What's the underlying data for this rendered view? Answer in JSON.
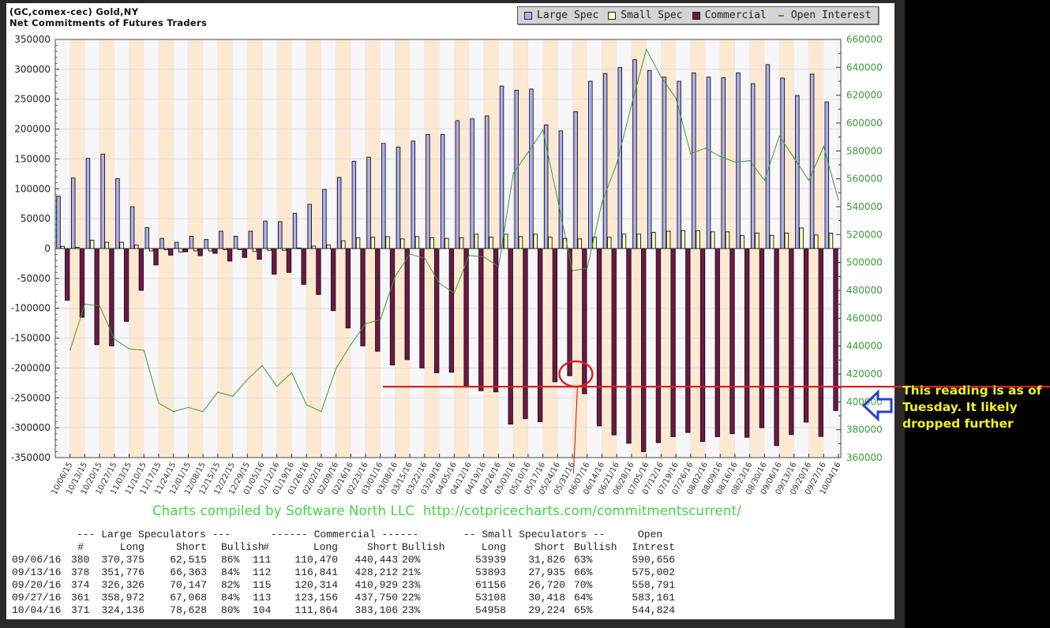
{
  "header": {
    "line1": "(GC,comex-cec) Gold,NY",
    "line2": "Net Commitments of Futures Traders"
  },
  "legend": [
    {
      "label": "Large Spec",
      "color": "#b0b0ee"
    },
    {
      "label": "Small Spec",
      "color": "#ffffc0"
    },
    {
      "label": "Commercial",
      "color": "#6e1846"
    },
    {
      "label": "Open Interest",
      "color": "#3a9a3a"
    }
  ],
  "credit": "Charts compiled by Software North LLC  http://cotpricecharts.com/commitmentscurrent/",
  "annotation": {
    "text1": "This reading is as of",
    "text2": "Tuesday.  It likely",
    "text3": "dropped further"
  },
  "table": {
    "group_headers": {
      "large": "--- Large Speculators ---",
      "commercial": "------ Commercial ------",
      "small": "-- Small Speculators --",
      "oi": "Open"
    },
    "columns": [
      "",
      "#",
      "Long",
      "Short",
      "Bullish",
      "#",
      "Long",
      "Short",
      "Bullish",
      "Long",
      "Short",
      "Bullish",
      "Intrest"
    ],
    "rows": [
      [
        "09/06/16",
        "380",
        "370,375",
        "62,515",
        "86%",
        "111",
        "110,470",
        "440,443",
        "20%",
        "53939",
        "31,826",
        "63%",
        "590,656"
      ],
      [
        "09/13/16",
        "378",
        "351,776",
        "66,363",
        "84%",
        "112",
        "116,841",
        "428,212",
        "21%",
        "53893",
        "27,935",
        "66%",
        "575,002"
      ],
      [
        "09/20/16",
        "374",
        "326,326",
        "70,147",
        "82%",
        "115",
        "120,314",
        "410,929",
        "23%",
        "61156",
        "26,720",
        "70%",
        "558,791"
      ],
      [
        "09/27/16",
        "361",
        "358,972",
        "67,068",
        "84%",
        "113",
        "123,156",
        "437,750",
        "22%",
        "53108",
        "30,418",
        "64%",
        "583,161"
      ],
      [
        "10/04/16",
        "371",
        "324,136",
        "78,628",
        "80%",
        "104",
        "111,864",
        "383,106",
        "23%",
        "54958",
        "29,224",
        "65%",
        "544,824"
      ]
    ]
  },
  "chart_data": {
    "type": "bar",
    "title": "Net Commitments of Futures Traders",
    "ylim": [
      -350000,
      350000
    ],
    "y2lim": [
      360000,
      660000
    ],
    "left_axis_ticks": [
      "350000",
      "300000",
      "250000",
      "200000",
      "150000",
      "100000",
      "50000",
      "0",
      "-50000",
      "-100000",
      "-150000",
      "-200000",
      "-250000",
      "-300000",
      "-350000"
    ],
    "right_axis_ticks": [
      "660000",
      "640000",
      "620000",
      "600000",
      "580000",
      "560000",
      "540000",
      "520000",
      "500000",
      "480000",
      "460000",
      "440000",
      "420000",
      "400000",
      "380000",
      "360000"
    ],
    "categories": [
      "10/06/15",
      "10/13/15",
      "10/20/15",
      "10/27/15",
      "11/03/15",
      "11/10/15",
      "11/17/15",
      "11/24/15",
      "12/01/15",
      "12/08/15",
      "12/15/15",
      "12/22/15",
      "12/29/15",
      "01/05/16",
      "01/12/16",
      "01/19/16",
      "01/26/16",
      "02/02/16",
      "02/09/16",
      "02/16/16",
      "02/23/16",
      "03/01/16",
      "03/08/16",
      "03/15/16",
      "03/22/16",
      "03/29/16",
      "04/05/16",
      "04/12/16",
      "04/19/16",
      "04/26/16",
      "05/03/16",
      "05/10/16",
      "05/17/16",
      "05/24/16",
      "05/31/16",
      "06/07/16",
      "06/14/16",
      "06/21/16",
      "06/28/16",
      "07/05/16",
      "07/12/16",
      "07/19/16",
      "07/26/16",
      "08/02/16",
      "08/09/16",
      "08/16/16",
      "08/23/16",
      "08/30/16",
      "09/06/16",
      "09/13/16",
      "09/20/16",
      "09/27/16",
      "10/04/16"
    ],
    "series": [
      {
        "name": "Large Spec",
        "axis": "left",
        "values": [
          87500,
          118000,
          151000,
          158000,
          117000,
          70000,
          35000,
          17000,
          10500,
          20600,
          15000,
          29000,
          20600,
          29000,
          46000,
          45000,
          59000,
          74000,
          99000,
          119000,
          146000,
          153000,
          176000,
          170000,
          180000,
          191000,
          191000,
          214000,
          217000,
          222000,
          272000,
          265000,
          267000,
          207000,
          197000,
          229000,
          280000,
          293000,
          303000,
          316000,
          298000,
          287000,
          280000,
          294000,
          287000,
          286000,
          294000,
          276000,
          307860,
          285413,
          256179,
          291904,
          245508
        ]
      },
      {
        "name": "Small Spec",
        "axis": "left",
        "values": [
          3700,
          2000,
          14000,
          10500,
          10500,
          6000,
          -4000,
          -2000,
          -6000,
          -4000,
          -4000,
          -2000,
          -2000,
          -5000,
          -3000,
          -3000,
          1000,
          4000,
          6000,
          13000,
          18000,
          19000,
          20000,
          16000,
          20000,
          18000,
          17000,
          18000,
          24000,
          19000,
          24000,
          20000,
          24000,
          19000,
          17000,
          16000,
          19000,
          19000,
          24000,
          24000,
          27000,
          29000,
          30000,
          30000,
          28000,
          28000,
          22000,
          26000,
          22113,
          25972,
          34436,
          22690,
          25734
        ]
      },
      {
        "name": "Commercial",
        "axis": "left",
        "values": [
          -86600,
          -115000,
          -161000,
          -163000,
          -122000,
          -70000,
          -27500,
          -11000,
          -5500,
          -12000,
          -8000,
          -21000,
          -15000,
          -18000,
          -43000,
          -40000,
          -60000,
          -77000,
          -104000,
          -133000,
          -163000,
          -172000,
          -195000,
          -186000,
          -200000,
          -208000,
          -207000,
          -230000,
          -238000,
          -240000,
          -294000,
          -285000,
          -290000,
          -223000,
          -213000,
          -243000,
          -297000,
          -312000,
          -326000,
          -340000,
          -325000,
          -315000,
          -308000,
          -323000,
          -315000,
          -310000,
          -316000,
          -300000,
          -329973,
          -311371,
          -290615,
          -314594,
          -271242
        ]
      },
      {
        "name": "Open Interest",
        "axis": "right",
        "type": "line",
        "values": [
          437000,
          470000,
          469000,
          445000,
          438000,
          437000,
          399000,
          393000,
          396000,
          393000,
          407000,
          404000,
          416000,
          426000,
          411000,
          421000,
          398000,
          393000,
          424000,
          441000,
          456000,
          459000,
          490000,
          506000,
          503000,
          485000,
          478000,
          505000,
          504000,
          497000,
          564000,
          579000,
          595000,
          545000,
          494000,
          496000,
          543000,
          571000,
          613000,
          653000,
          633000,
          618000,
          578000,
          582000,
          576000,
          572000,
          573000,
          559000,
          590656,
          575002,
          558791,
          583161,
          544824
        ]
      }
    ],
    "grid": true,
    "legend_position": "top-right",
    "highlight_level": -230000
  }
}
